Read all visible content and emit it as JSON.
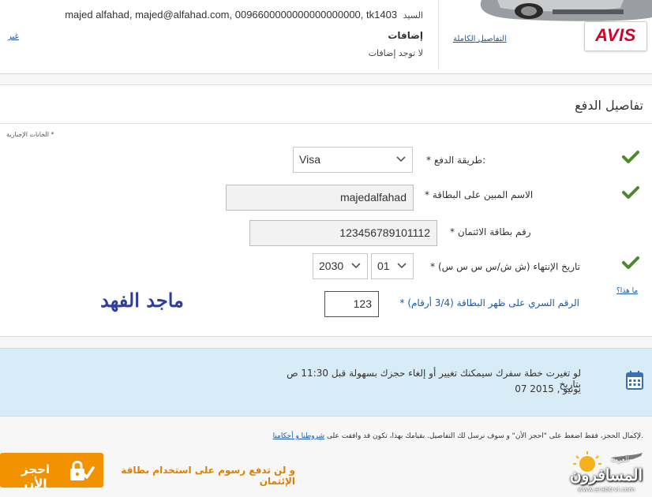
{
  "summary": {
    "traveler_title": "السيد",
    "traveler_details": "majed alfahad, majed@alfahad.com, 0096600000000000000000, tk1403",
    "extras_title": "إضافات",
    "extras_value": "لا توجد إضافات",
    "change_link": "غير",
    "full_details_link": "التفاصيل الكاملة",
    "brand_logo": "AVIS"
  },
  "payment": {
    "title": "تفاصيل الدفع",
    "mandatory_note": "الخانات الإجبارية *",
    "method_label": "* طريقة الدفع:",
    "method_value": "Visa",
    "name_label": "* الاسم المبين على البطاقة",
    "name_value": "majedalfahad",
    "card_label": "* رقم بطاقة الائتمان",
    "card_value": "123456789101112",
    "expiry_label": "* تاريخ الإنتهاء (ش ش/س س س س)",
    "expiry_month": "01",
    "expiry_year": "2030",
    "cvv_label": "*  الرقم السري على ظهر البطاقة  (3/4 أرقام)",
    "cvv_value": "123",
    "whats_this": "ما هذا؟"
  },
  "watermark_name": "ماجد الفهد",
  "info": {
    "line1": "لو تغيرت خطة سفرك سيمكنك تغيير أو إلغاء حجزك بسهولة قبل 11:30 ص بتاريخ",
    "line2": "07 يونيو , 2015",
    "icon": "calendar-icon"
  },
  "footer": {
    "terms_text": "لإكمال الحجز، فقط اضغط على \"احجز الأن\" و سوف نرسل لك التفاصيل. بقيامك بهذا، تكون قد وافقت على",
    "terms_link": "شروطنا و أحكامنا",
    "terms_end": ".",
    "book_button": "احجز الأن",
    "no_fees": "و لن تدفع رسوم على استخدام بطاقة الإئتمان"
  },
  "site_logo": {
    "name": "المسافرون",
    "tag": "العرب",
    "site": "www.arabtrvl.com"
  },
  "colors": {
    "accent_blue": "#1a5aa8",
    "check_green": "#4a8a2a",
    "book_orange": "#f39200",
    "info_bg": "#d8ecf7"
  }
}
